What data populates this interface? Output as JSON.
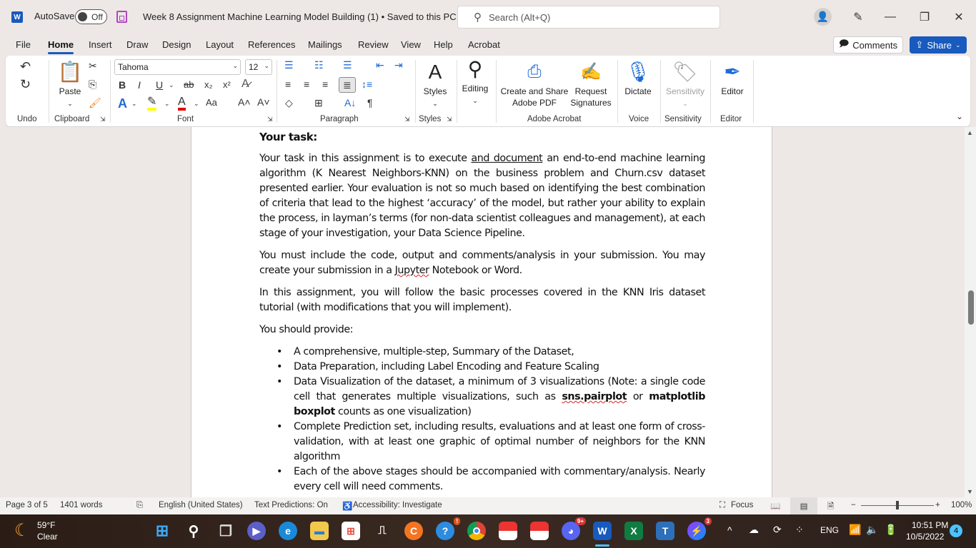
{
  "titlebar": {
    "app_icon": "word-icon",
    "autosave_label": "AutoSave",
    "autosave_state": "Off",
    "save_icon": "save-icon",
    "doc_title": "Week 8 Assignment Machine Learning Model Building (1) • Saved to this PC ⌄",
    "search_placeholder": "Search (Alt+Q)",
    "minimize": "—",
    "restore": "❐",
    "close": "✕"
  },
  "menu": {
    "tabs": [
      "File",
      "Home",
      "Insert",
      "Draw",
      "Design",
      "Layout",
      "References",
      "Mailings",
      "Review",
      "View",
      "Help",
      "Acrobat"
    ],
    "active": "Home",
    "comments_label": "Comments",
    "share_label": "Share"
  },
  "ribbon": {
    "groups": {
      "undo": "Undo",
      "clipboard": "Clipboard",
      "font": "Font",
      "paragraph": "Paragraph",
      "styles": "Styles",
      "adobe": "Adobe Acrobat",
      "voice": "Voice",
      "sensitivity": "Sensitivity",
      "editor": "Editor"
    },
    "paste_label": "Paste",
    "font_name": "Tahoma",
    "font_size": "12",
    "styles_label": "Styles",
    "editing_label": "Editing",
    "create_share_label_1": "Create and Share",
    "create_share_label_2": "Adobe PDF",
    "request_sig_label_1": "Request",
    "request_sig_label_2": "Signatures",
    "dictate_label": "Dictate",
    "sensitivity_label": "Sensitivity",
    "editor_label": "Editor",
    "font_buttons": {
      "bold": "B",
      "italic": "I",
      "underline": "U",
      "strike": "ab",
      "subscript": "x₂",
      "superscript": "x²",
      "change_case": "Aa",
      "grow": "A˄",
      "shrink": "A˅"
    },
    "highlight_color": "#ffff00",
    "font_color": "#e00000"
  },
  "document": {
    "heading": "Your task:",
    "p1_a": "Your task in this assignment is to execute ",
    "p1_u": "and document",
    "p1_b": " an end-to-end machine learning algorithm (K Nearest Neighbors-KNN) on the business problem and Churn.csv dataset presented earlier.  Your evaluation is not so much based on identifying the best combination of criteria that lead to the highest ‘accuracy’ of the model, but rather your ability to explain the process, in layman’s terms (for non-data scientist colleagues and management), at each stage of your investigation, your Data Science Pipeline.",
    "p2_a": "You must include the code, output and comments/analysis in your submission.  You may create your submission in a ",
    "p2_sq": "Jupyter",
    "p2_b": " Notebook or Word.",
    "p3": "In this assignment, you will follow the basic processes covered in the KNN Iris dataset tutorial (with modifications that you will implement).",
    "p4": "You should provide:",
    "bullets": {
      "b1": "A comprehensive, multiple-step, Summary of the Dataset,",
      "b2": "Data Preparation, including Label Encoding and Feature Scaling",
      "b3_a": "Data Visualization of the dataset, a minimum of 3 visualizations (Note: a single code cell that generates multiple visualizations, such as ",
      "b3_bold1": "sns.pairplot",
      "b3_mid": " or ",
      "b3_bold2": "matplotlib boxplot",
      "b3_b": " counts as one visualization)",
      "b4": "Complete Prediction set, including results, evaluations and at least one form of cross-validation, with at least one graphic of optimal number of neighbors for the KNN algorithm",
      "b5": "Each of the above stages should be accompanied with commentary/analysis. Nearly every cell will need comments."
    }
  },
  "statusbar": {
    "page": "Page 3 of 5",
    "words": "1401 words",
    "language": "English (United States)",
    "text_predictions": "Text Predictions: On",
    "accessibility": "Accessibility: Investigate",
    "focus": "Focus",
    "zoom": "100%",
    "zoom_minus": "−",
    "zoom_plus": "+"
  },
  "taskbar": {
    "weather_temp": "59°F",
    "weather_desc": "Clear",
    "discord_badge": "9+",
    "messenger_badge": "3",
    "help_badge": "!",
    "language": "ENG",
    "time": "10:51 PM",
    "date": "10/5/2022",
    "notifications": "4"
  }
}
